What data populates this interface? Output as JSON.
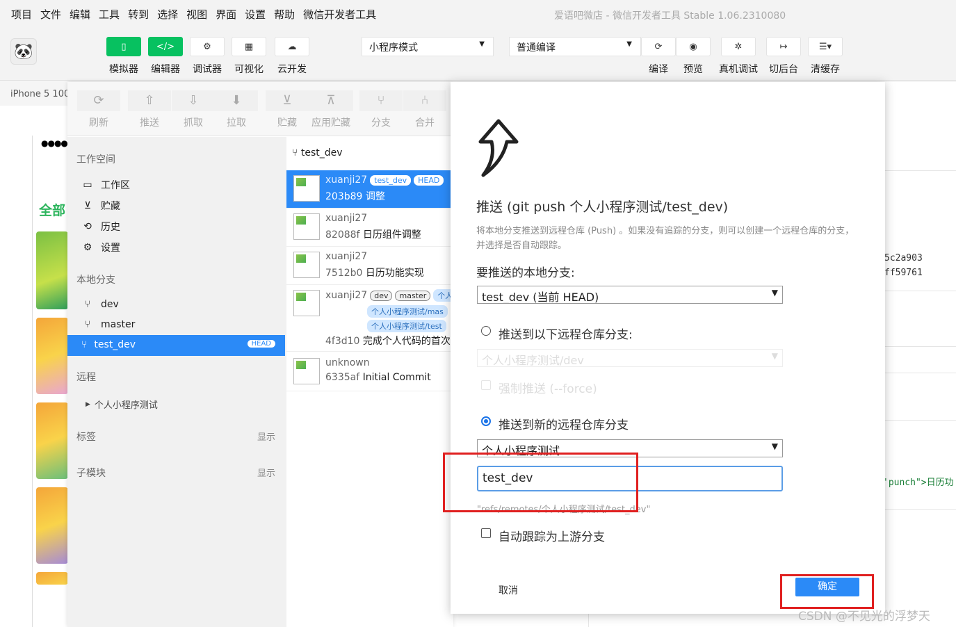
{
  "menu": [
    "项目",
    "文件",
    "编辑",
    "工具",
    "转到",
    "选择",
    "视图",
    "界面",
    "设置",
    "帮助",
    "微信开发者工具"
  ],
  "app_title": "爱语吧微店 - 微信开发者工具 Stable 1.06.2310080",
  "toolbar": {
    "simulator": "模拟器",
    "editor": "编辑器",
    "debugger": "调试器",
    "visual": "可视化",
    "cloud": "云开发",
    "mode_select": "小程序模式",
    "compile_select": "普通编译",
    "compile": "编译",
    "preview": "预览",
    "remote_debug": "真机调试",
    "background": "切后台",
    "clear_cache": "清缓存"
  },
  "simulator": {
    "device": "iPhone 5 100",
    "dots": "●●●●●",
    "category": "全部"
  },
  "git_toolbar": [
    "刷新",
    "推送",
    "抓取",
    "拉取",
    "贮藏",
    "应用贮藏",
    "分支",
    "合并"
  ],
  "git_sidebar": {
    "workspace_title": "工作空间",
    "workspace_items": [
      "工作区",
      "贮藏",
      "历史",
      "设置"
    ],
    "local_branches_title": "本地分支",
    "branches": [
      "dev",
      "master",
      "test_dev"
    ],
    "head_badge": "HEAD",
    "remote_title": "远程",
    "remote_item": "个人小程序测试",
    "tags_title": "标签",
    "submodules_title": "子模块",
    "show_label": "显示"
  },
  "commits": {
    "branch_header": "test_dev",
    "items": [
      {
        "author": "xuanji27",
        "tags": [
          "test_dev",
          "HEAD"
        ],
        "hash": "203b89",
        "message": "调整"
      },
      {
        "author": "xuanji27",
        "tags": [],
        "hash": "82088f",
        "message": "日历组件调整"
      },
      {
        "author": "xuanji27",
        "tags": [],
        "hash": "7512b0",
        "message": "日历功能实现"
      },
      {
        "author": "xuanji27",
        "tags": [
          "dev",
          "master",
          "个人"
        ],
        "remote_tags": [
          "个人小程序测试/mas",
          "个人小程序测试/test"
        ],
        "hash": "4f3d10",
        "message": "完成个人代码的首次"
      },
      {
        "author": "unknown",
        "tags": [],
        "hash": "6335af",
        "message": "Initial Commit"
      }
    ]
  },
  "right_panel": {
    "hash1": "5c2a903",
    "hash2": "ff59761",
    "code": "'punch\">日历功"
  },
  "dialog": {
    "icon": "push-arrow",
    "title": "推送 (git push 个人小程序测试/test_dev)",
    "description": "将本地分支推送到远程仓库 (Push) 。如果没有追踪的分支，则可以创建一个远程仓库的分支，并选择是否自动跟踪。",
    "local_branch_label": "要推送的本地分支:",
    "local_branch_value": "test_dev (当前 HEAD)",
    "option_existing": "推送到以下远程仓库分支:",
    "existing_branch_value": "个人小程序测试/dev",
    "force_push": "强制推送 (--force)",
    "option_new": "推送到新的远程仓库分支",
    "remote_value": "个人小程序测试",
    "new_branch_input": "test_dev",
    "ref_hint": "\"refs/remotes/个人小程序测试/test_dev\"",
    "auto_track": "自动跟踪为上游分支",
    "cancel": "取消",
    "confirm": "确定"
  },
  "watermark": "CSDN @不见光的浮梦天",
  "colors": {
    "accent": "#2b8af7",
    "green": "#07c160",
    "highlight": "#e02020"
  }
}
